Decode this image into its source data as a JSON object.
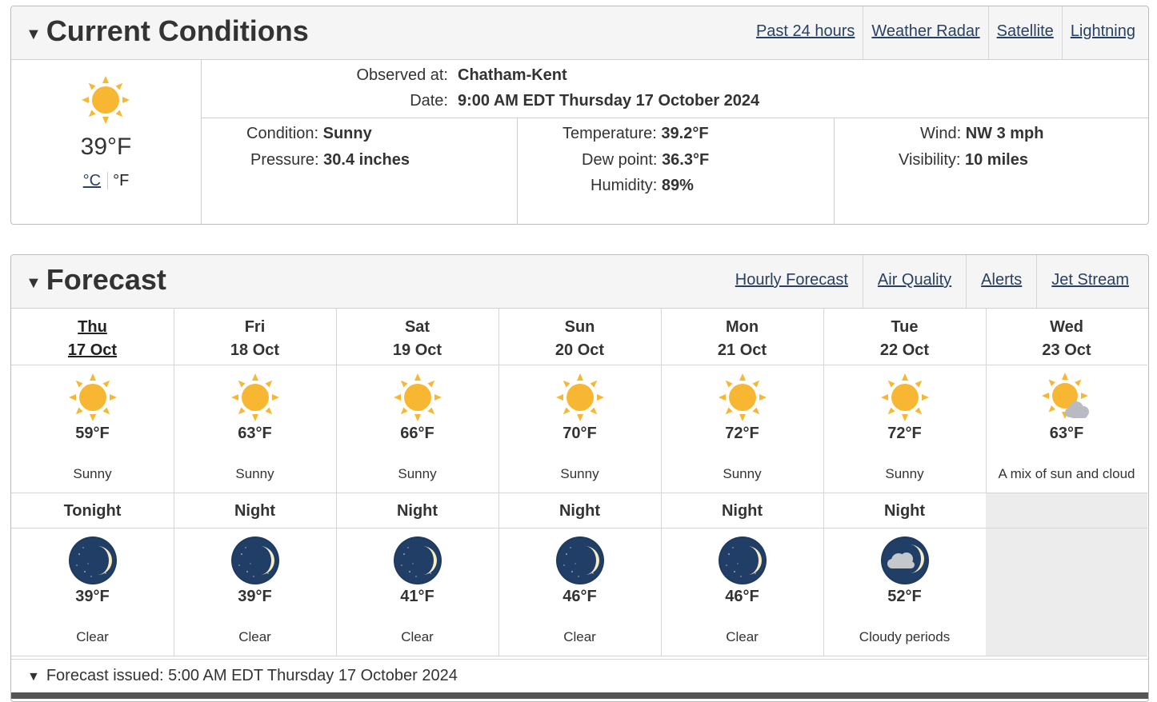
{
  "current": {
    "title": "Current Conditions",
    "links": [
      "Past 24 hours",
      "Weather Radar",
      "Satellite",
      "Lightning"
    ],
    "temp_display": "39°F",
    "unit_c": "°C",
    "unit_f": "°F",
    "observed_label": "Observed at:",
    "observed_value": "Chatham-Kent",
    "date_label": "Date:",
    "date_value": "9:00 AM EDT Thursday 17 October 2024",
    "condition_label": "Condition:",
    "condition_value": "Sunny",
    "pressure_label": "Pressure:",
    "pressure_value": "30.4 inches",
    "temperature_label": "Temperature:",
    "temperature_value": "39.2°F",
    "dewpoint_label": "Dew point:",
    "dewpoint_value": "36.3°F",
    "humidity_label": "Humidity:",
    "humidity_value": "89%",
    "wind_label": "Wind:",
    "wind_value": "NW 3 mph",
    "visibility_label": "Visibility:",
    "visibility_value": "10 miles",
    "icon": "sun-icon"
  },
  "forecast": {
    "title": "Forecast",
    "links": [
      "Hourly Forecast",
      "Air Quality",
      "Alerts",
      "Jet Stream"
    ],
    "days": [
      {
        "dow": "Thu",
        "date": "17 Oct",
        "temp": "59°F",
        "summary": "Sunny",
        "icon": "sun-icon",
        "night_label": "Tonight",
        "night_temp": "39°F",
        "night_summary": "Clear",
        "night_icon": "moon-icon"
      },
      {
        "dow": "Fri",
        "date": "18 Oct",
        "temp": "63°F",
        "summary": "Sunny",
        "icon": "sun-icon",
        "night_label": "Night",
        "night_temp": "39°F",
        "night_summary": "Clear",
        "night_icon": "moon-icon"
      },
      {
        "dow": "Sat",
        "date": "19 Oct",
        "temp": "66°F",
        "summary": "Sunny",
        "icon": "sun-icon",
        "night_label": "Night",
        "night_temp": "41°F",
        "night_summary": "Clear",
        "night_icon": "moon-icon"
      },
      {
        "dow": "Sun",
        "date": "20 Oct",
        "temp": "70°F",
        "summary": "Sunny",
        "icon": "sun-icon",
        "night_label": "Night",
        "night_temp": "46°F",
        "night_summary": "Clear",
        "night_icon": "moon-icon"
      },
      {
        "dow": "Mon",
        "date": "21 Oct",
        "temp": "72°F",
        "summary": "Sunny",
        "icon": "sun-icon",
        "night_label": "Night",
        "night_temp": "46°F",
        "night_summary": "Clear",
        "night_icon": "moon-icon"
      },
      {
        "dow": "Tue",
        "date": "22 Oct",
        "temp": "72°F",
        "summary": "Sunny",
        "icon": "sun-icon",
        "night_label": "Night",
        "night_temp": "52°F",
        "night_summary": "Cloudy periods",
        "night_icon": "moon-cloud-icon"
      },
      {
        "dow": "Wed",
        "date": "23 Oct",
        "temp": "63°F",
        "summary": "A mix of sun and cloud",
        "icon": "sun-cloud-icon",
        "night_label": "",
        "night_temp": "",
        "night_summary": "",
        "night_icon": ""
      }
    ],
    "issued_text": "Forecast issued: 5:00 AM EDT Thursday 17 October 2024"
  },
  "colors": {
    "link": "#284162",
    "sun": "#f7b733",
    "moon_bg": "#1f3a5f",
    "moon": "#f6edc2",
    "cloud": "#b8bcc2"
  }
}
